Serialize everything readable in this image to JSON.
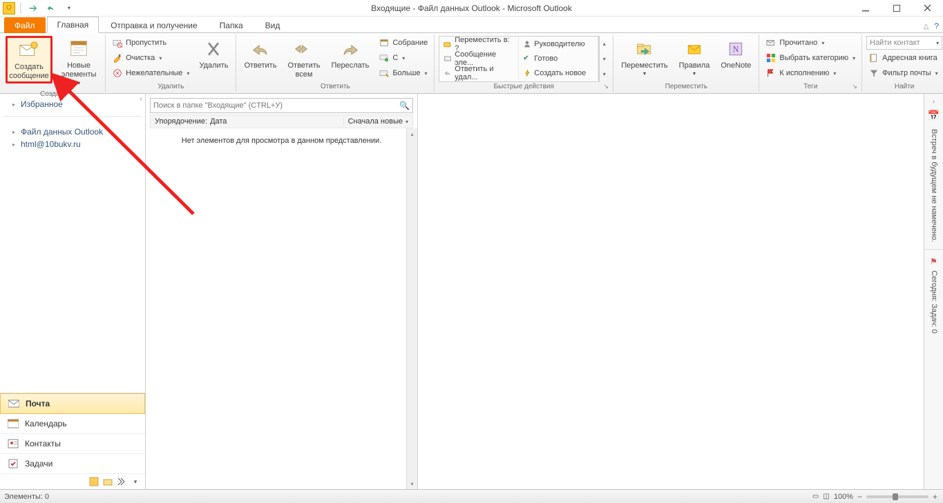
{
  "window": {
    "title": "Входящие - Файл данных Outlook  -  Microsoft Outlook"
  },
  "tabs": {
    "file": {
      "label": "Файл"
    },
    "home": {
      "label": "Главная"
    },
    "sendrecv": {
      "label": "Отправка и получение"
    },
    "folder": {
      "label": "Папка"
    },
    "view": {
      "label": "Вид"
    }
  },
  "ribbon": {
    "new": {
      "create_msg_line1": "Создать",
      "create_msg_line2": "сообщение",
      "new_items_line1": "Новые",
      "new_items_line2": "элементы",
      "group": "Создать"
    },
    "delete": {
      "ignore": "Пропустить",
      "cleanup": "Очистка",
      "junk": "Нежелательные",
      "delete_btn": "Удалить",
      "group": "Удалить"
    },
    "respond": {
      "reply": "Ответить",
      "reply_all_line1": "Ответить",
      "reply_all_line2": "всем",
      "forward": "Переслать",
      "meeting": "Собрание",
      "im": "С",
      "more": "Больше",
      "group": "Ответить"
    },
    "quicksteps": {
      "move_to": "Переместить в: ?",
      "to_manager": "Руководителю",
      "team_email": "Сообщение эле...",
      "done": "Готово",
      "reply_delete": "Ответить и удал...",
      "create_new": "Создать новое",
      "group": "Быстрые действия"
    },
    "move": {
      "move": "Переместить",
      "rules": "Правила",
      "onenote": "OneNote",
      "group": "Переместить"
    },
    "tags": {
      "unread": "Прочитано",
      "categorize": "Выбрать категорию",
      "followup": "К исполнению",
      "group": "Теги"
    },
    "find": {
      "find_contact": "Найти контакт",
      "address_book": "Адресная книга",
      "filter": "Фильтр почты",
      "group": "Найти"
    }
  },
  "nav": {
    "favorites": "Избранное",
    "data_file": "Файл данных Outlook",
    "account": "html@10bukv.ru",
    "mail": "Почта",
    "calendar": "Календарь",
    "contacts": "Контакты",
    "tasks": "Задачи"
  },
  "list": {
    "search_placeholder": "Поиск в папке \"Входящие\" (CTRL+У)",
    "arrange_by": "Упорядочение:",
    "arrange_field": "Дата",
    "newest_on_top": "Сначала новые",
    "empty": "Нет элементов для просмотра в данном представлении."
  },
  "todo": {
    "no_appts": "Встреч в будущем не намечено.",
    "today_tasks": "Сегодня: Задач: 0"
  },
  "status": {
    "items": "Элементы: 0",
    "zoom": "100%"
  }
}
